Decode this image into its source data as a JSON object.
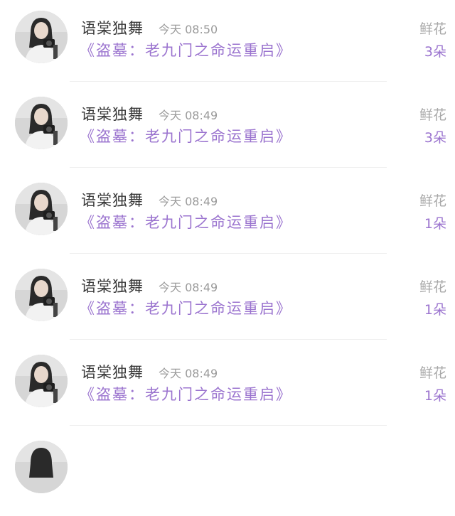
{
  "records": [
    {
      "user": "语棠独舞",
      "time": "今天 08:50",
      "book": "《盗墓：老九门之命运重启》",
      "gift": "鲜花",
      "count": "3朵"
    },
    {
      "user": "语棠独舞",
      "time": "今天 08:49",
      "book": "《盗墓：老九门之命运重启》",
      "gift": "鲜花",
      "count": "3朵"
    },
    {
      "user": "语棠独舞",
      "time": "今天 08:49",
      "book": "《盗墓：老九门之命运重启》",
      "gift": "鲜花",
      "count": "1朵"
    },
    {
      "user": "语棠独舞",
      "time": "今天 08:49",
      "book": "《盗墓：老九门之命运重启》",
      "gift": "鲜花",
      "count": "1朵"
    },
    {
      "user": "语棠独舞",
      "time": "今天 08:49",
      "book": "《盗墓：老九门之命运重启》",
      "gift": "鲜花",
      "count": "1朵"
    }
  ],
  "colors": {
    "accent": "#9b74cf",
    "name": "#3a3a3a",
    "muted": "#9a9a9a",
    "divider": "#eeeeee"
  }
}
